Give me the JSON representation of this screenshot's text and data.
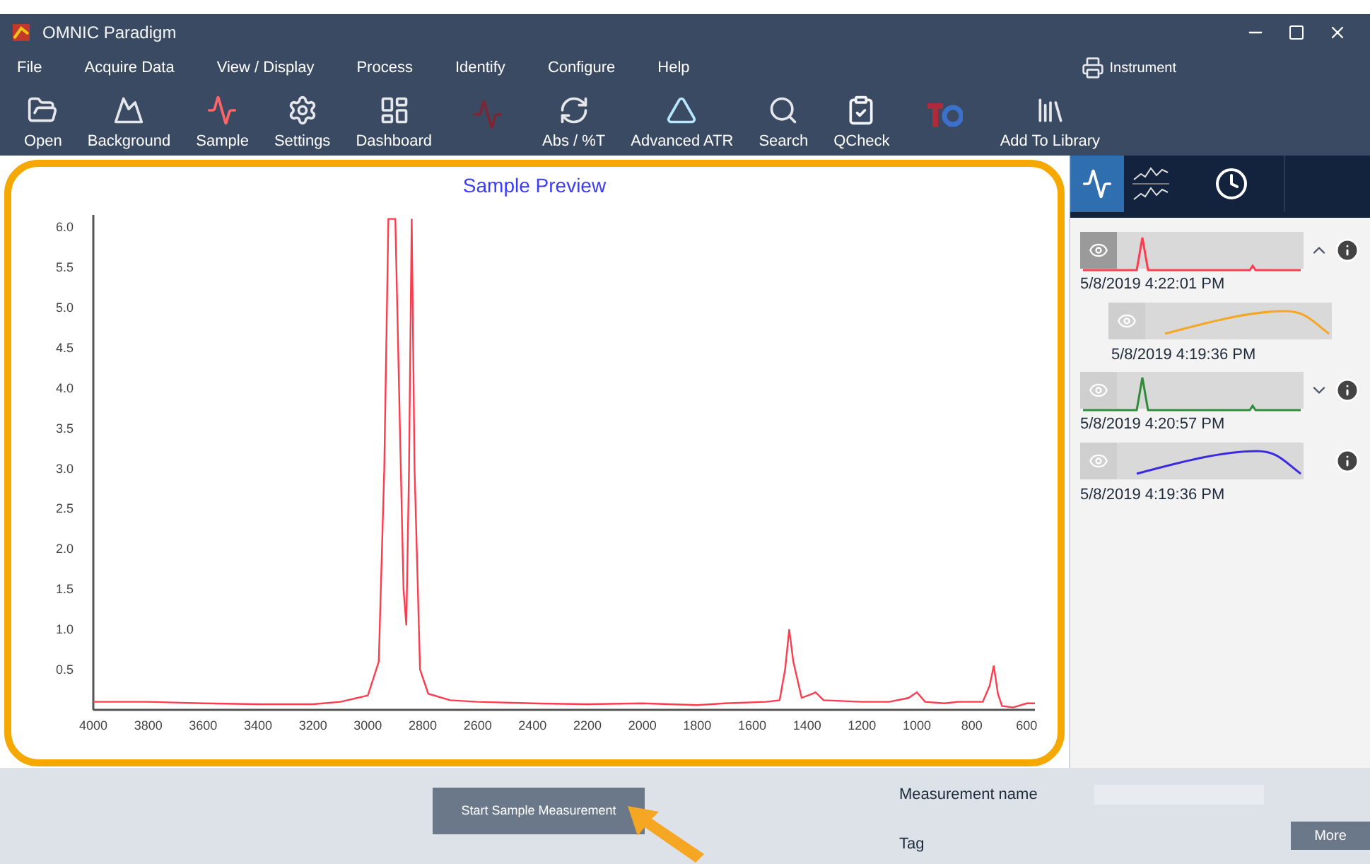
{
  "window": {
    "title": "OMNIC Paradigm"
  },
  "menu": [
    "File",
    "Acquire Data",
    "View / Display",
    "Process",
    "Identify",
    "Configure",
    "Help"
  ],
  "instrument": {
    "label": "Instrument"
  },
  "toolbar": [
    {
      "kind": "open",
      "label": "Open",
      "disabled": false
    },
    {
      "kind": "background",
      "label": "Background",
      "disabled": false
    },
    {
      "kind": "sample",
      "label": "Sample",
      "disabled": false
    },
    {
      "kind": "settings",
      "label": "Settings",
      "disabled": false
    },
    {
      "kind": "dashboard",
      "label": "Dashboard",
      "disabled": false
    },
    {
      "kind": "spectrum",
      "disabled": true
    },
    {
      "kind": "absorbance",
      "label": "Abs / %T",
      "disabled": false
    },
    {
      "kind": "atr",
      "label": "Advanced ATR",
      "disabled": false
    },
    {
      "kind": "search",
      "label": "Search",
      "disabled": false
    },
    {
      "kind": "qcheck",
      "label": "QCheck",
      "disabled": false
    },
    {
      "kind": "tq",
      "disabled": true
    },
    {
      "kind": "library",
      "label": "Add To Library",
      "disabled": false
    }
  ],
  "preview": {
    "title": "Sample Preview",
    "chart_data": {
      "type": "line",
      "xlim": [
        4000,
        570
      ],
      "ylim": [
        0,
        6.15
      ],
      "xticks": [
        4000,
        3800,
        3600,
        3400,
        3200,
        3000,
        2800,
        2600,
        2400,
        2200,
        2000,
        1800,
        1600,
        1400,
        1200,
        1000,
        800,
        600
      ],
      "yticks": [
        {
          "value": 0.5,
          "label": "0.5"
        },
        {
          "value": 1,
          "label": "1.0"
        },
        {
          "value": 1.5,
          "label": "1.5"
        },
        {
          "value": 2,
          "label": "2.0"
        },
        {
          "value": 2.5,
          "label": "2.5"
        },
        {
          "value": 3,
          "label": "3.0"
        },
        {
          "value": 3.5,
          "label": "3.5"
        },
        {
          "value": 4,
          "label": "4.0"
        },
        {
          "value": 4.5,
          "label": "4.5"
        },
        {
          "value": 5,
          "label": "5.0"
        },
        {
          "value": 5.5,
          "label": "5.5"
        },
        {
          "value": 6,
          "label": "6.0"
        }
      ],
      "x": [
        4000,
        3800,
        3600,
        3400,
        3200,
        3100,
        3000,
        2960,
        2940,
        2925,
        2900,
        2880,
        2870,
        2860,
        2850,
        2840,
        2830,
        2810,
        2780,
        2700,
        2600,
        2400,
        2200,
        2000,
        1800,
        1700,
        1550,
        1500,
        1480,
        1465,
        1450,
        1420,
        1380,
        1370,
        1340,
        1200,
        1100,
        1030,
        1000,
        970,
        900,
        850,
        760,
        735,
        720,
        705,
        690,
        650,
        600,
        570
      ],
      "series": [
        {
          "color": "#ff3b4e",
          "values": [
            0.1,
            0.1,
            0.08,
            0.07,
            0.07,
            0.1,
            0.18,
            0.6,
            3.0,
            6.1,
            6.1,
            3.0,
            1.5,
            1.05,
            3.0,
            6.1,
            3.0,
            0.5,
            0.2,
            0.12,
            0.1,
            0.08,
            0.07,
            0.08,
            0.06,
            0.08,
            0.1,
            0.12,
            0.5,
            1.0,
            0.6,
            0.15,
            0.2,
            0.22,
            0.12,
            0.1,
            0.1,
            0.15,
            0.22,
            0.1,
            0.08,
            0.1,
            0.1,
            0.3,
            0.55,
            0.2,
            0.05,
            0.03,
            0.08,
            0.08
          ]
        }
      ]
    }
  },
  "side_tabs": [
    {
      "kind": "single",
      "selected": true
    },
    {
      "kind": "stacked",
      "selected": false
    },
    {
      "kind": "history",
      "selected": false
    }
  ],
  "spectra": [
    {
      "timestamp": "5/8/2019 4:22:01 PM",
      "color": "#ff3b4e",
      "kind": "sharp",
      "visible": true,
      "expanded": true,
      "children": [
        {
          "timestamp": "5/8/2019 4:19:36 PM",
          "color": "#f5a623",
          "kind": "broad",
          "visible": false
        }
      ]
    },
    {
      "timestamp": "5/8/2019 4:20:57 PM",
      "color": "#2e8b3a",
      "kind": "sharp",
      "visible": false,
      "expanded": false
    },
    {
      "timestamp": "5/8/2019 4:19:36 PM",
      "color": "#3a2be0",
      "kind": "broad",
      "visible": false
    }
  ],
  "bottom": {
    "start_button": "Start Sample Measurement",
    "name_label": "Measurement name",
    "tag_label": "Tag",
    "more_button": "More"
  }
}
